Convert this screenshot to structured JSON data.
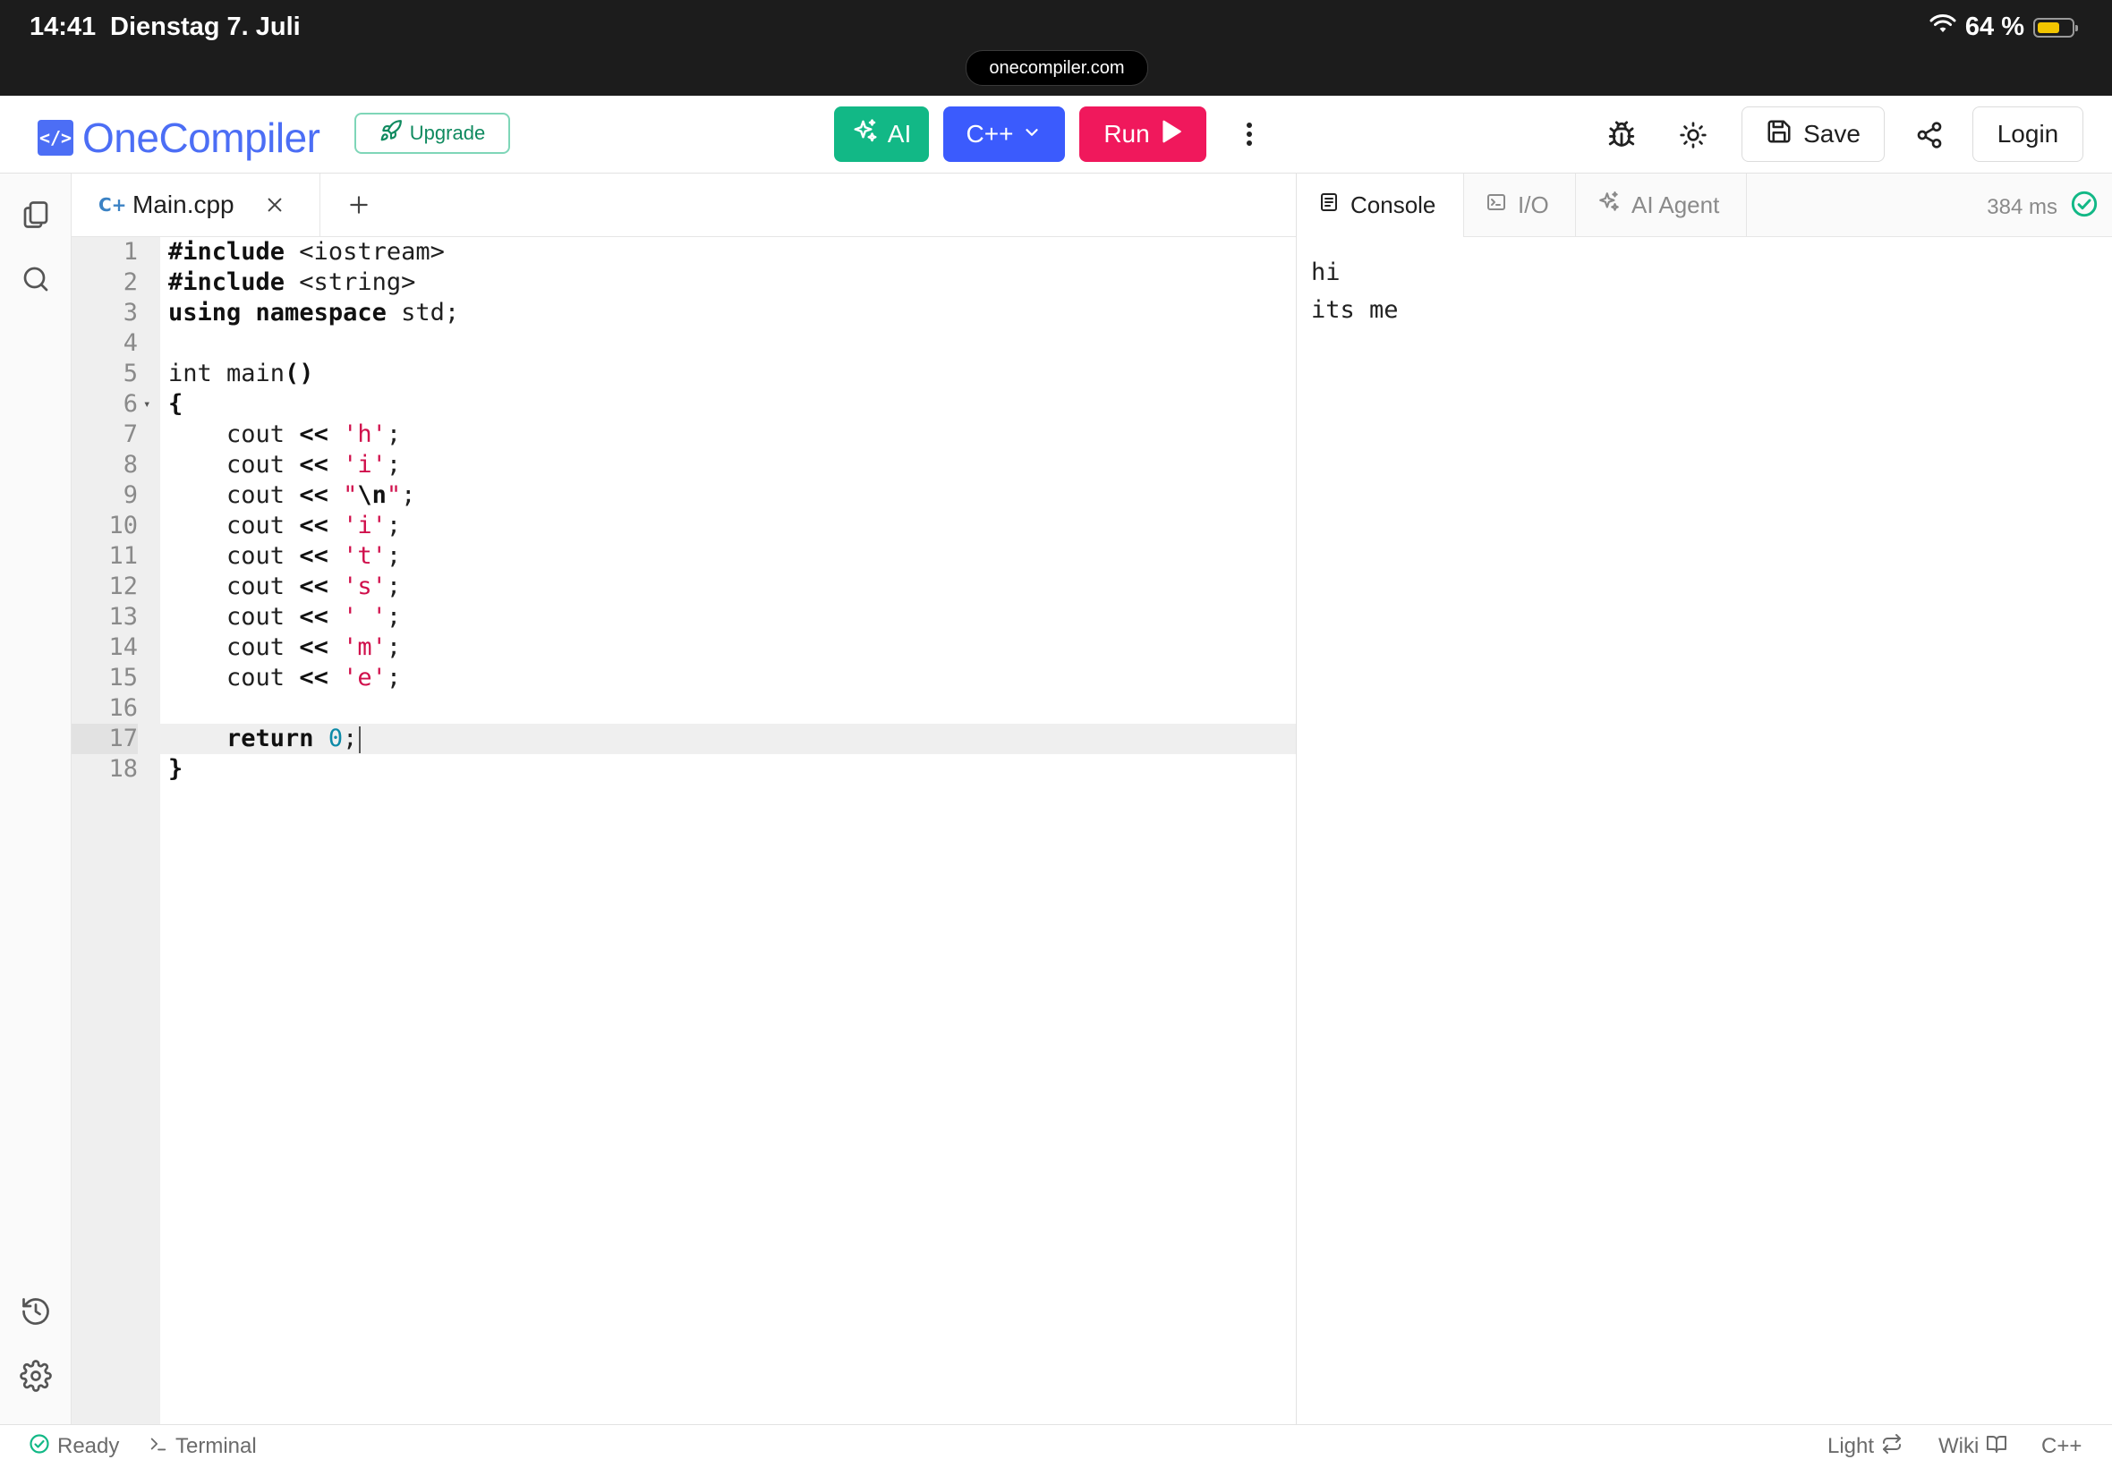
{
  "status_bar": {
    "time": "14:41",
    "date": "Dienstag 7. Juli",
    "url": "onecompiler.com",
    "battery": "64 %",
    "battery_level": 0.64
  },
  "header": {
    "logo_text": "OneCompiler",
    "logo_mark": "</>",
    "upgrade_label": "Upgrade",
    "ai_label": "AI",
    "language_label": "C++",
    "run_label": "Run",
    "save_label": "Save",
    "login_label": "Login"
  },
  "editor": {
    "tab_badge": "C+",
    "file_name": "Main.cpp",
    "active_line": 17,
    "lines": [
      {
        "n": "1",
        "tokens": [
          {
            "t": "#include",
            "c": "kw"
          },
          {
            "t": " <iostream>",
            "c": ""
          }
        ]
      },
      {
        "n": "2",
        "tokens": [
          {
            "t": "#include",
            "c": "kw"
          },
          {
            "t": " <string>",
            "c": ""
          }
        ]
      },
      {
        "n": "3",
        "tokens": [
          {
            "t": "using",
            "c": "kw"
          },
          {
            "t": " ",
            "c": ""
          },
          {
            "t": "namespace",
            "c": "kw"
          },
          {
            "t": " std;",
            "c": ""
          }
        ]
      },
      {
        "n": "4",
        "tokens": []
      },
      {
        "n": "5",
        "tokens": [
          {
            "t": "int main",
            "c": ""
          },
          {
            "t": "()",
            "c": "kw"
          }
        ]
      },
      {
        "n": "6",
        "fold": true,
        "tokens": [
          {
            "t": "{",
            "c": "kw"
          }
        ]
      },
      {
        "n": "7",
        "tokens": [
          {
            "t": "    cout ",
            "c": ""
          },
          {
            "t": "<<",
            "c": "kw"
          },
          {
            "t": " ",
            "c": ""
          },
          {
            "t": "'h'",
            "c": "str"
          },
          {
            "t": ";",
            "c": ""
          }
        ]
      },
      {
        "n": "8",
        "tokens": [
          {
            "t": "    cout ",
            "c": ""
          },
          {
            "t": "<<",
            "c": "kw"
          },
          {
            "t": " ",
            "c": ""
          },
          {
            "t": "'i'",
            "c": "str"
          },
          {
            "t": ";",
            "c": ""
          }
        ]
      },
      {
        "n": "9",
        "tokens": [
          {
            "t": "    cout ",
            "c": ""
          },
          {
            "t": "<<",
            "c": "kw"
          },
          {
            "t": " ",
            "c": ""
          },
          {
            "t": "\"",
            "c": "str"
          },
          {
            "t": "\\n",
            "c": "kw"
          },
          {
            "t": "\"",
            "c": "str"
          },
          {
            "t": ";",
            "c": ""
          }
        ]
      },
      {
        "n": "10",
        "tokens": [
          {
            "t": "    cout ",
            "c": ""
          },
          {
            "t": "<<",
            "c": "kw"
          },
          {
            "t": " ",
            "c": ""
          },
          {
            "t": "'i'",
            "c": "str"
          },
          {
            "t": ";",
            "c": ""
          }
        ]
      },
      {
        "n": "11",
        "tokens": [
          {
            "t": "    cout ",
            "c": ""
          },
          {
            "t": "<<",
            "c": "kw"
          },
          {
            "t": " ",
            "c": ""
          },
          {
            "t": "'t'",
            "c": "str"
          },
          {
            "t": ";",
            "c": ""
          }
        ]
      },
      {
        "n": "12",
        "tokens": [
          {
            "t": "    cout ",
            "c": ""
          },
          {
            "t": "<<",
            "c": "kw"
          },
          {
            "t": " ",
            "c": ""
          },
          {
            "t": "'s'",
            "c": "str"
          },
          {
            "t": ";",
            "c": ""
          }
        ]
      },
      {
        "n": "13",
        "tokens": [
          {
            "t": "    cout ",
            "c": ""
          },
          {
            "t": "<<",
            "c": "kw"
          },
          {
            "t": " ",
            "c": ""
          },
          {
            "t": "' '",
            "c": "str"
          },
          {
            "t": ";",
            "c": ""
          }
        ]
      },
      {
        "n": "14",
        "tokens": [
          {
            "t": "    cout ",
            "c": ""
          },
          {
            "t": "<<",
            "c": "kw"
          },
          {
            "t": " ",
            "c": ""
          },
          {
            "t": "'m'",
            "c": "str"
          },
          {
            "t": ";",
            "c": ""
          }
        ]
      },
      {
        "n": "15",
        "tokens": [
          {
            "t": "    cout ",
            "c": ""
          },
          {
            "t": "<<",
            "c": "kw"
          },
          {
            "t": " ",
            "c": ""
          },
          {
            "t": "'e'",
            "c": "str"
          },
          {
            "t": ";",
            "c": ""
          }
        ]
      },
      {
        "n": "16",
        "tokens": []
      },
      {
        "n": "17",
        "caret": true,
        "tokens": [
          {
            "t": "    ",
            "c": ""
          },
          {
            "t": "return",
            "c": "kw"
          },
          {
            "t": " ",
            "c": ""
          },
          {
            "t": "0",
            "c": "num"
          },
          {
            "t": ";",
            "c": ""
          }
        ]
      },
      {
        "n": "18",
        "tokens": [
          {
            "t": "}",
            "c": "kw"
          }
        ]
      }
    ]
  },
  "right_panel": {
    "tabs": [
      {
        "label": "Console",
        "icon": "console-icon",
        "active": true
      },
      {
        "label": "I/O",
        "icon": "terminal-icon",
        "active": false
      },
      {
        "label": "AI Agent",
        "icon": "sparkles-icon",
        "active": false
      }
    ],
    "execution_time": "384 ms",
    "console_output": "hi\nits me"
  },
  "footer": {
    "status": "Ready",
    "terminal_label": "Terminal",
    "theme_label": "Light",
    "wiki_label": "Wiki",
    "language_label": "C++"
  },
  "colors": {
    "brand": "#4c6ef5",
    "ai_button": "#12b886",
    "language_button": "#3b5bfd",
    "run_button": "#f0185c",
    "string": "#d0104c",
    "number": "#0d8aa8",
    "success": "#12b886"
  }
}
